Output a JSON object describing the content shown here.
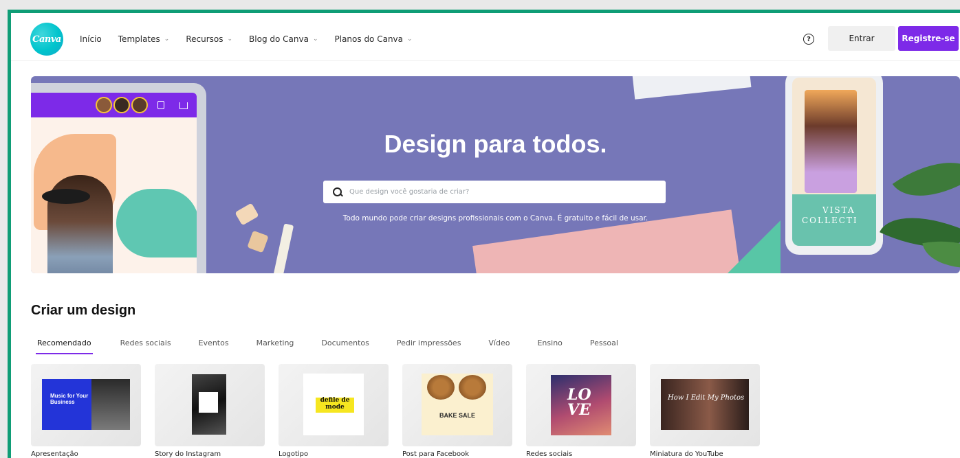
{
  "header": {
    "logo_text": "Canva",
    "nav": [
      {
        "label": "Início",
        "has_dropdown": false
      },
      {
        "label": "Templates",
        "has_dropdown": true
      },
      {
        "label": "Recursos",
        "has_dropdown": true
      },
      {
        "label": "Blog do Canva",
        "has_dropdown": true
      },
      {
        "label": "Planos do Canva",
        "has_dropdown": true
      }
    ],
    "help_icon": "?",
    "login_label": "Entrar",
    "signup_label": "Registre-se"
  },
  "hero": {
    "title": "Design para todos.",
    "search_placeholder": "Que design você gostaria de criar?",
    "subtitle": "Todo mundo pode criar designs profissionais com o Canva. É gratuito e fácil de usar.",
    "phone_caption_line1": "VISTA",
    "phone_caption_line2": "COLLECTI"
  },
  "create": {
    "title": "Criar um design",
    "tabs": [
      "Recomendado",
      "Redes sociais",
      "Eventos",
      "Marketing",
      "Documentos",
      "Pedir impressões",
      "Vídeo",
      "Ensino",
      "Pessoal"
    ],
    "active_tab": "Recomendado",
    "cards": [
      {
        "label": "Apresentação",
        "thumb_text": "Music for Your Business"
      },
      {
        "label": "Story do Instagram",
        "thumb_text": ""
      },
      {
        "label": "Logotipo",
        "thumb_text": "defile de mode"
      },
      {
        "label": "Post para Facebook",
        "thumb_text": "BAKE SALE"
      },
      {
        "label": "Redes sociais",
        "thumb_text": "LO VE"
      },
      {
        "label": "Miniatura do YouTube",
        "thumb_text": "How I Edit My Photos"
      }
    ]
  },
  "colors": {
    "frame": "#0f9d76",
    "brand_purple": "#7d2ae8",
    "hero_bg": "#7677b8",
    "logo_teal": "#00c4cc"
  }
}
